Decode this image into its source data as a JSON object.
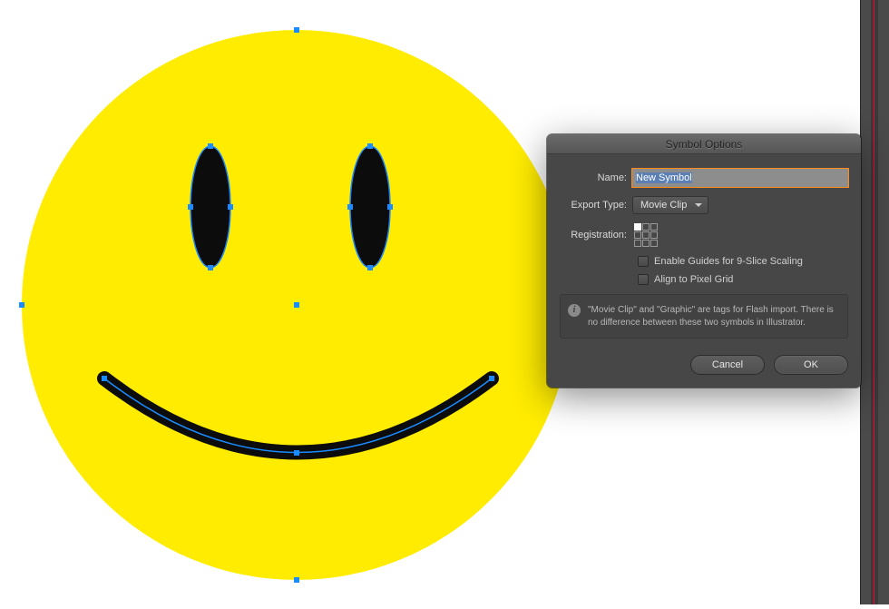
{
  "artwork": {
    "face_fill": "#ffec00",
    "eye_fill": "#0c0c0c",
    "mouth_stroke": "#0c0c0c",
    "selection_color": "#1a8cff"
  },
  "dialog": {
    "title": "Symbol Options",
    "name_label": "Name:",
    "name_value": "New Symbol",
    "export_type_label": "Export Type:",
    "export_type_value": "Movie Clip",
    "registration_label": "Registration:",
    "enable_guides_label": "Enable Guides for 9-Slice Scaling",
    "align_pixel_label": "Align to Pixel Grid",
    "info_text": "\"Movie Clip\" and \"Graphic\" are tags for Flash import. There is no difference between these two symbols in Illustrator.",
    "cancel_label": "Cancel",
    "ok_label": "OK"
  }
}
